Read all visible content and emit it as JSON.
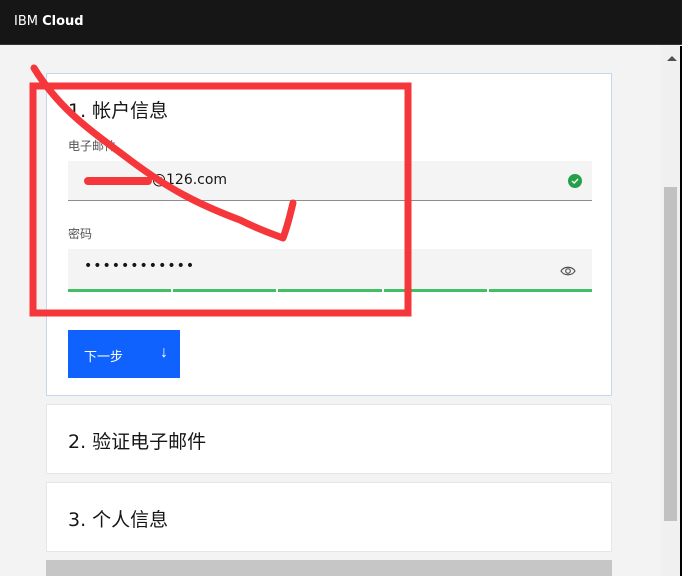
{
  "header": {
    "brand_light": "IBM",
    "brand_bold": "Cloud"
  },
  "steps": [
    {
      "title": "1. 帐户信息",
      "state": "active",
      "fields": {
        "email_label": "电子邮件",
        "email_value": "@126.com",
        "email_status": "valid",
        "password_label": "密码",
        "password_value": "••••••••••••",
        "password_strength_segments_filled": 5,
        "password_strength_segments_total": 5
      },
      "next_button": "下一步",
      "next_icon": "arrow-down-icon"
    },
    {
      "title": "2. 验证电子邮件",
      "state": "collapsed"
    },
    {
      "title": "3. 个人信息",
      "state": "collapsed"
    }
  ],
  "colors": {
    "primary": "#0f62fe",
    "success": "#24a148",
    "strength": "#42be65",
    "annotation": "#f5363a",
    "header_bg": "#161616"
  },
  "annotation": {
    "type": "red-box-with-checkmark-stroke"
  }
}
